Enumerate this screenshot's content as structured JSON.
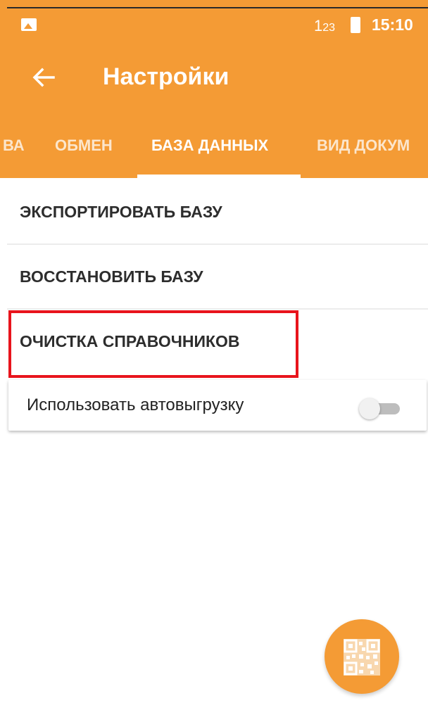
{
  "status_bar": {
    "gallery_icon": "image-icon",
    "input_indicator": "1 23",
    "battery_icon": "battery-icon",
    "time": "15:10"
  },
  "toolbar": {
    "back_icon": "arrow-left-icon",
    "title": "Настройки"
  },
  "tabs": [
    {
      "label": "ВА",
      "active": false
    },
    {
      "label": "ОБМЕН",
      "active": false
    },
    {
      "label": "БАЗА ДАННЫХ",
      "active": true
    },
    {
      "label": "ВИД ДОКУМ",
      "active": false
    }
  ],
  "settings": {
    "export_db": "ЭКСПОРТИРОВАТЬ БАЗУ",
    "restore_db": "ВОССТАНОВИТЬ БАЗУ",
    "clear_directories": "ОЧИСТКА СПРАВОЧНИКОВ",
    "auto_upload": {
      "label": "Использовать автовыгрузку",
      "enabled": false
    }
  },
  "fab": {
    "icon": "qr-code-icon"
  },
  "colors": {
    "accent": "#f49b35",
    "highlight": "#e8141c"
  }
}
